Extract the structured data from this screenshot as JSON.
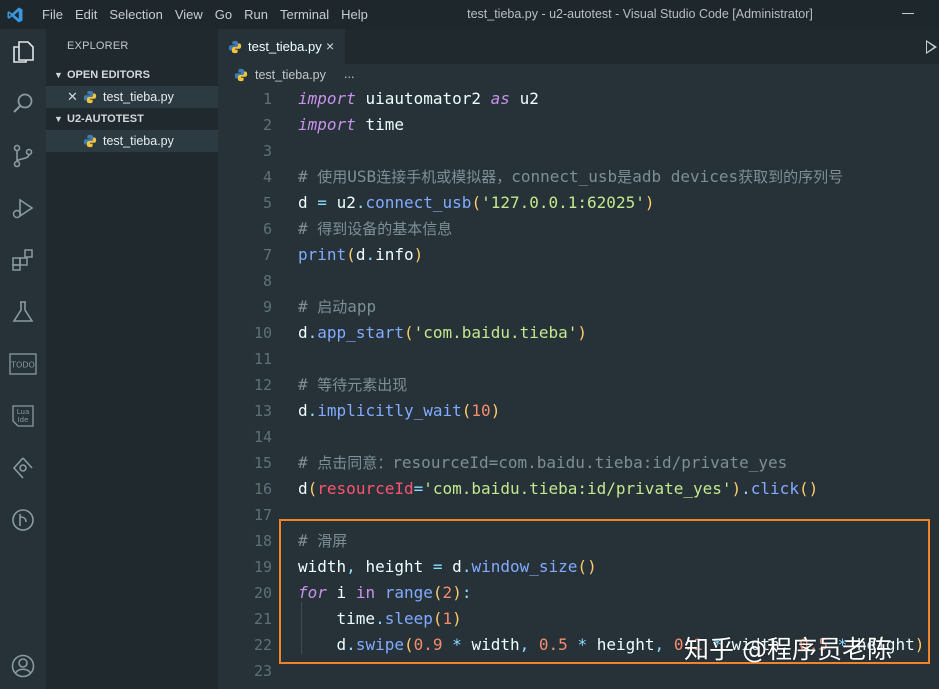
{
  "window": {
    "title": "test_tieba.py - u2-autotest - Visual Studio Code [Administrator]"
  },
  "menu": [
    "File",
    "Edit",
    "Selection",
    "View",
    "Go",
    "Run",
    "Terminal",
    "Help"
  ],
  "activity_bar": [
    "explorer-icon",
    "search-icon",
    "source-control-icon",
    "run-debug-icon",
    "extensions-icon",
    "testing-icon",
    "todo-icon",
    "lua-ide-icon",
    "git-graph-icon",
    "git-lens-icon",
    "account-icon"
  ],
  "activity_labels": {
    "todo": "TODO",
    "lua": "Lua\nIde"
  },
  "sidebar": {
    "title": "EXPLORER",
    "open_editors": {
      "label": "OPEN EDITORS",
      "files": [
        "test_tieba.py"
      ]
    },
    "workspace": {
      "label": "U2-AUTOTEST",
      "files": [
        "test_tieba.py"
      ]
    }
  },
  "tab": {
    "label": "test_tieba.py",
    "close": "×"
  },
  "breadcrumb": {
    "file": "test_tieba.py",
    "more": "..."
  },
  "code_lines": [
    "import uiautomator2 as u2",
    "import time",
    "",
    "# 使用USB连接手机或模拟器，connect_usb是adb devices获取到的序列号",
    "d = u2.connect_usb('127.0.0.1:62025')",
    "# 得到设备的基本信息",
    "print(d.info)",
    "",
    "# 启动app",
    "d.app_start('com.baidu.tieba')",
    "",
    "# 等待元素出现",
    "d.implicitly_wait(10)",
    "",
    "# 点击同意：resourceId=com.baidu.tieba:id/private_yes",
    "d(resourceId='com.baidu.tieba:id/private_yes').click()",
    "",
    "# 滑屏",
    "width, height = d.window_size()",
    "for i in range(2):",
    "    time.sleep(1)",
    "    d.swipe(0.9 * width, 0.5 * height, 0.1 * width, 0.5 * height)",
    ""
  ],
  "line_numbers": [
    "1",
    "2",
    "3",
    "4",
    "5",
    "6",
    "7",
    "8",
    "9",
    "10",
    "11",
    "12",
    "13",
    "14",
    "15",
    "16",
    "17",
    "18",
    "19",
    "20",
    "21",
    "22",
    "23"
  ],
  "watermark": "知乎 @程序员老陈",
  "colors": {
    "background": "#263238",
    "keyword": "#c792ea",
    "string": "#c3e88d",
    "function": "#82aaff",
    "number": "#f78c6c",
    "comment": "#7d8f96",
    "highlight_border": "#f0842b"
  }
}
